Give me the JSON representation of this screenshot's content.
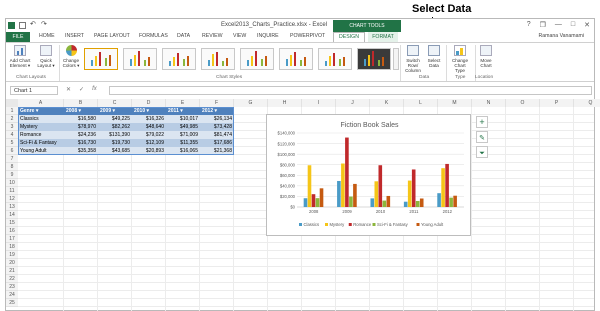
{
  "annotation": {
    "text": "Select Data"
  },
  "window": {
    "title": "Excel2013_Charts_Practice.xlsx - Excel",
    "chart_tools_label": "CHART TOOLS",
    "help": "?",
    "restore": "❐",
    "minimize": "—",
    "maximize": "□",
    "close": "✕"
  },
  "tabs": [
    {
      "label": "FILE"
    },
    {
      "label": "HOME"
    },
    {
      "label": "INSERT"
    },
    {
      "label": "PAGE LAYOUT"
    },
    {
      "label": "FORMULAS"
    },
    {
      "label": "DATA"
    },
    {
      "label": "REVIEW"
    },
    {
      "label": "VIEW"
    },
    {
      "label": "INQUIRE"
    },
    {
      "label": "POWERPIVOT"
    },
    {
      "label": "DESIGN"
    },
    {
      "label": "FORMAT"
    }
  ],
  "user_name": "Ramana Vanamami",
  "ribbon": {
    "add_chart_element": "Add Chart Element ▾",
    "quick_layout": "Quick Layout ▾",
    "change_colors": "Change Colors ▾",
    "switch_row_column": "Switch Row/ Column",
    "select_data": "Select Data",
    "change_chart_type": "Change Chart Type",
    "move_chart": "Move Chart",
    "group_chart_layouts": "Chart Layouts",
    "group_chart_styles": "Chart Styles",
    "group_data": "Data",
    "group_type": "Type",
    "group_location": "Location"
  },
  "formula_bar": {
    "name_box": "Chart 1",
    "cancel": "✕",
    "enter": "✓",
    "fx": "fx"
  },
  "sheet": {
    "columns": [
      "A",
      "B",
      "C",
      "D",
      "E",
      "F",
      "G",
      "H",
      "I",
      "J",
      "K",
      "L",
      "M",
      "N",
      "O",
      "P",
      "Q"
    ],
    "rows": [
      "1",
      "2",
      "3",
      "4",
      "5",
      "6",
      "7",
      "8",
      "9",
      "10",
      "11",
      "12",
      "13",
      "14",
      "15",
      "16",
      "17",
      "18",
      "19",
      "20",
      "21",
      "22",
      "23",
      "24",
      "25"
    ],
    "table": {
      "headers": [
        "Genre",
        "2008",
        "2009",
        "2010",
        "2011",
        "2012"
      ],
      "rows": [
        {
          "genre": "Classics",
          "v": [
            "$16,580",
            "$49,225",
            "$16,326",
            "$10,017",
            "$26,134"
          ]
        },
        {
          "genre": "Mystery",
          "v": [
            "$78,970",
            "$82,262",
            "$48,640",
            "$49,985",
            "$73,428"
          ]
        },
        {
          "genre": "Romance",
          "v": [
            "$24,236",
            "$131,390",
            "$79,022",
            "$71,009",
            "$81,474"
          ]
        },
        {
          "genre": "Sci-Fi & Fantasy",
          "v": [
            "$16,730",
            "$19,730",
            "$12,109",
            "$11,355",
            "$17,686"
          ]
        },
        {
          "genre": "Young Adult",
          "v": [
            "$35,358",
            "$43,685",
            "$20,893",
            "$16,065",
            "$21,368"
          ]
        }
      ]
    }
  },
  "colors": {
    "excel_green": "#217346",
    "header_blue": "#4f81bd",
    "classics": "#4a9bc7",
    "mystery": "#f5c518",
    "romance": "#c0292b",
    "scifi": "#8cb63c",
    "young_adult": "#c55a11"
  },
  "chart_data": {
    "type": "bar",
    "title": "Fiction Book Sales",
    "categories": [
      "2008",
      "2009",
      "2010",
      "2011",
      "2012"
    ],
    "series": [
      {
        "name": "Classics",
        "values": [
          16580,
          49225,
          16326,
          10017,
          26134
        ]
      },
      {
        "name": "Mystery",
        "values": [
          78970,
          82262,
          48640,
          49985,
          73428
        ]
      },
      {
        "name": "Romance",
        "values": [
          24236,
          131390,
          79022,
          71009,
          81474
        ]
      },
      {
        "name": "Sci-Fi & Fantasy",
        "values": [
          16730,
          19730,
          12109,
          11355,
          17686
        ]
      },
      {
        "name": "Young Adult",
        "values": [
          35358,
          43685,
          20893,
          16065,
          21368
        ]
      }
    ],
    "yticks": [
      "$0",
      "$20,000",
      "$40,000",
      "$60,000",
      "$80,000",
      "$100,000",
      "$120,000",
      "$140,000"
    ],
    "ylim": [
      0,
      140000
    ],
    "grid": true,
    "legend": "bottom"
  }
}
